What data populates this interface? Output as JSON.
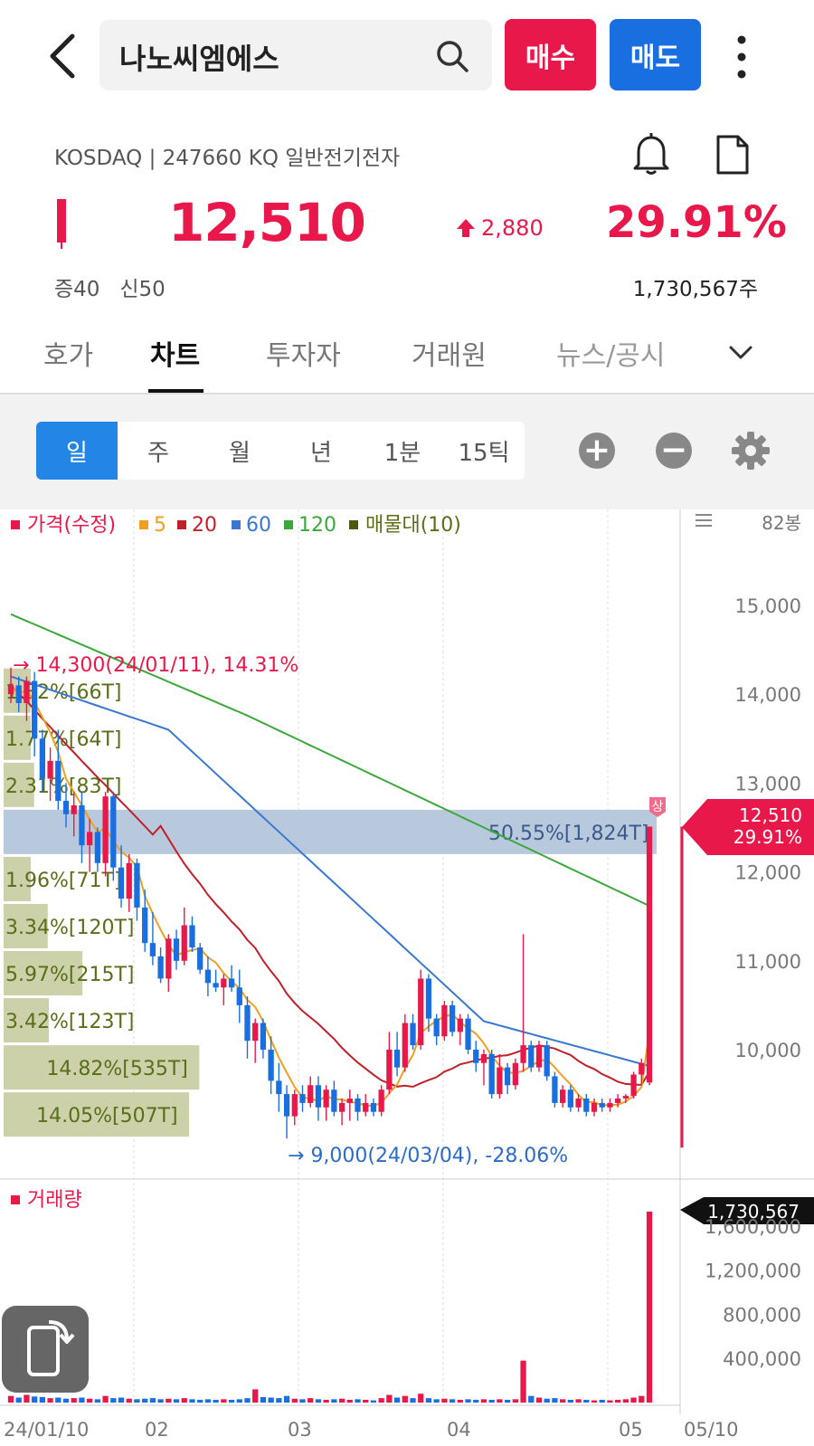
{
  "header": {
    "search_value": "나노씨엠에스",
    "buy_label": "매수",
    "sell_label": "매도"
  },
  "stock": {
    "meta": "KOSDAQ | 247660 KQ 일반전기전자",
    "price": "12,510",
    "change": "2,880",
    "change_pct": "29.91%",
    "margin_info": "증40   신50",
    "volume_total": "1,730,567주"
  },
  "tabs": [
    "호가",
    "차트",
    "투자자",
    "거래원",
    "뉴스/공시"
  ],
  "periods": [
    "일",
    "주",
    "월",
    "년",
    "1분",
    "15틱"
  ],
  "legend": {
    "price": "가격(수정)",
    "ma5": "5",
    "ma20": "20",
    "ma60": "60",
    "ma120": "120",
    "volume_profile": "매물대(10)",
    "bars_count": "82봉",
    "volume_title": "거래량"
  },
  "colors": {
    "up": "#e8194a",
    "down": "#1a6fe0",
    "ma5": "#f0a020",
    "ma20": "#c0202a",
    "ma60": "#3a78d0",
    "ma120": "#3aa83a",
    "profile": "#5a6e1a"
  },
  "chart_data": {
    "type": "candlestick",
    "y_ticks": [
      "15,000",
      "14,000",
      "13,000",
      "12,000",
      "11,000",
      "10,000"
    ],
    "x_ticks": [
      "24/01/10",
      "02",
      "03",
      "04",
      "05",
      "05/10"
    ],
    "annotations": {
      "high": "14,300(24/01/11), 14.31%",
      "low": "9,000(24/03/04), -28.06%",
      "limit_up_badge": "상",
      "current_price": "12,510",
      "current_pct": "29.91%"
    },
    "volume_profile": [
      {
        "label": "1.82%[66T]",
        "share": 1.82
      },
      {
        "label": "1.77%[64T]",
        "share": 1.77
      },
      {
        "label": "2.31%[83T]",
        "share": 2.31
      },
      {
        "label": "50.55%[1,824T]",
        "share": 50.55
      },
      {
        "label": "1.96%[71T]",
        "share": 1.96
      },
      {
        "label": "3.34%[120T]",
        "share": 3.34
      },
      {
        "label": "5.97%[215T]",
        "share": 5.97
      },
      {
        "label": "3.42%[123T]",
        "share": 3.42
      },
      {
        "label": "14.82%[535T]",
        "share": 14.82
      },
      {
        "label": "14.05%[507T]",
        "share": 14.05
      }
    ],
    "volume_ticks": [
      "1,600,000",
      "1,200,000",
      "800,000",
      "400,000"
    ],
    "volume_last": "1,730,567",
    "candles": [
      [
        14000,
        14300,
        13900,
        14100
      ],
      [
        14100,
        14200,
        13800,
        13900
      ],
      [
        13900,
        14200,
        13700,
        14150
      ],
      [
        14150,
        14250,
        13300,
        13500
      ],
      [
        13500,
        13600,
        12900,
        13050
      ],
      [
        13050,
        13400,
        12800,
        13250
      ],
      [
        13250,
        13600,
        12700,
        12800
      ],
      [
        12800,
        13000,
        12500,
        12650
      ],
      [
        12650,
        12900,
        12400,
        12750
      ],
      [
        12750,
        12900,
        12100,
        12300
      ],
      [
        12300,
        12600,
        12000,
        12450
      ],
      [
        12450,
        12500,
        12000,
        12100
      ],
      [
        12100,
        12900,
        11950,
        12850
      ],
      [
        12850,
        12900,
        11900,
        12050
      ],
      [
        12050,
        12300,
        11600,
        11700
      ],
      [
        11700,
        12200,
        11550,
        12100
      ],
      [
        12100,
        12150,
        11450,
        11600
      ],
      [
        11600,
        11800,
        11100,
        11200
      ],
      [
        11200,
        11550,
        10950,
        11050
      ],
      [
        11050,
        11150,
        10750,
        10800
      ],
      [
        10800,
        11300,
        10650,
        11250
      ],
      [
        11250,
        11350,
        10900,
        11000
      ],
      [
        11000,
        11600,
        10950,
        11400
      ],
      [
        11400,
        11500,
        11100,
        11150
      ],
      [
        11150,
        11200,
        10850,
        10900
      ],
      [
        10900,
        11050,
        10600,
        10750
      ],
      [
        10750,
        10900,
        10650,
        10700
      ],
      [
        10700,
        10850,
        10500,
        10800
      ],
      [
        10800,
        10950,
        10650,
        10700
      ],
      [
        10700,
        10900,
        10300,
        10500
      ],
      [
        10500,
        10600,
        9900,
        10100
      ],
      [
        10100,
        10350,
        9850,
        10300
      ],
      [
        10300,
        10350,
        9900,
        10000
      ],
      [
        10000,
        10150,
        9500,
        9650
      ],
      [
        9650,
        9850,
        9300,
        9500
      ],
      [
        9500,
        9600,
        9000,
        9250
      ],
      [
        9250,
        9550,
        9150,
        9500
      ],
      [
        9500,
        9600,
        9300,
        9400
      ],
      [
        9400,
        9700,
        9350,
        9600
      ],
      [
        9600,
        9700,
        9200,
        9350
      ],
      [
        9350,
        9600,
        9200,
        9550
      ],
      [
        9550,
        9650,
        9250,
        9300
      ],
      [
        9300,
        9450,
        9150,
        9400
      ],
      [
        9400,
        9550,
        9200,
        9450
      ],
      [
        9450,
        9500,
        9200,
        9300
      ],
      [
        9300,
        9500,
        9250,
        9400
      ],
      [
        9400,
        9450,
        9250,
        9300
      ],
      [
        9300,
        9600,
        9250,
        9550
      ],
      [
        9550,
        10200,
        9500,
        10000
      ],
      [
        10000,
        10200,
        9700,
        9800
      ],
      [
        9800,
        10400,
        9750,
        10300
      ],
      [
        10300,
        10400,
        10000,
        10050
      ],
      [
        10050,
        10900,
        10000,
        10800
      ],
      [
        10800,
        10850,
        10200,
        10350
      ],
      [
        10350,
        10400,
        10050,
        10150
      ],
      [
        10150,
        10550,
        10100,
        10500
      ],
      [
        10500,
        10550,
        10150,
        10200
      ],
      [
        10200,
        10400,
        10050,
        10350
      ],
      [
        10350,
        10400,
        9950,
        10000
      ],
      [
        10000,
        10100,
        9750,
        9850
      ],
      [
        9850,
        10000,
        9600,
        9950
      ],
      [
        9950,
        10000,
        9450,
        9500
      ],
      [
        9500,
        9950,
        9450,
        9800
      ],
      [
        9800,
        9850,
        9500,
        9600
      ],
      [
        9600,
        9900,
        9550,
        9850
      ],
      [
        9850,
        11300,
        9750,
        10050
      ],
      [
        10050,
        10100,
        9750,
        9800
      ],
      [
        9800,
        10100,
        9750,
        10050
      ],
      [
        10050,
        10100,
        9650,
        9700
      ],
      [
        9700,
        9750,
        9350,
        9400
      ],
      [
        9400,
        9600,
        9350,
        9550
      ],
      [
        9550,
        9600,
        9300,
        9350
      ],
      [
        9350,
        9500,
        9300,
        9450
      ],
      [
        9450,
        9500,
        9250,
        9300
      ],
      [
        9300,
        9450,
        9250,
        9400
      ],
      [
        9400,
        9450,
        9300,
        9350
      ],
      [
        9350,
        9450,
        9300,
        9400
      ],
      [
        9400,
        9500,
        9350,
        9450
      ],
      [
        9450,
        9500,
        9400,
        9480
      ],
      [
        9480,
        9750,
        9450,
        9720
      ],
      [
        9720,
        9900,
        9600,
        9850
      ],
      [
        9630,
        12510,
        9600,
        12510
      ]
    ],
    "volumes": [
      60,
      45,
      70,
      55,
      50,
      40,
      45,
      35,
      40,
      45,
      35,
      30,
      60,
      40,
      45,
      35,
      30,
      35,
      40,
      30,
      35,
      30,
      40,
      30,
      25,
      30,
      25,
      30,
      25,
      30,
      40,
      120,
      50,
      45,
      40,
      60,
      35,
      30,
      40,
      30,
      25,
      30,
      35,
      25,
      30,
      25,
      20,
      40,
      70,
      45,
      60,
      40,
      80,
      40,
      30,
      35,
      30,
      25,
      30,
      25,
      30,
      25,
      30,
      25,
      30,
      380,
      60,
      45,
      35,
      40,
      30,
      25,
      30,
      25,
      20,
      25,
      20,
      25,
      30,
      45,
      60,
      1730
    ]
  }
}
